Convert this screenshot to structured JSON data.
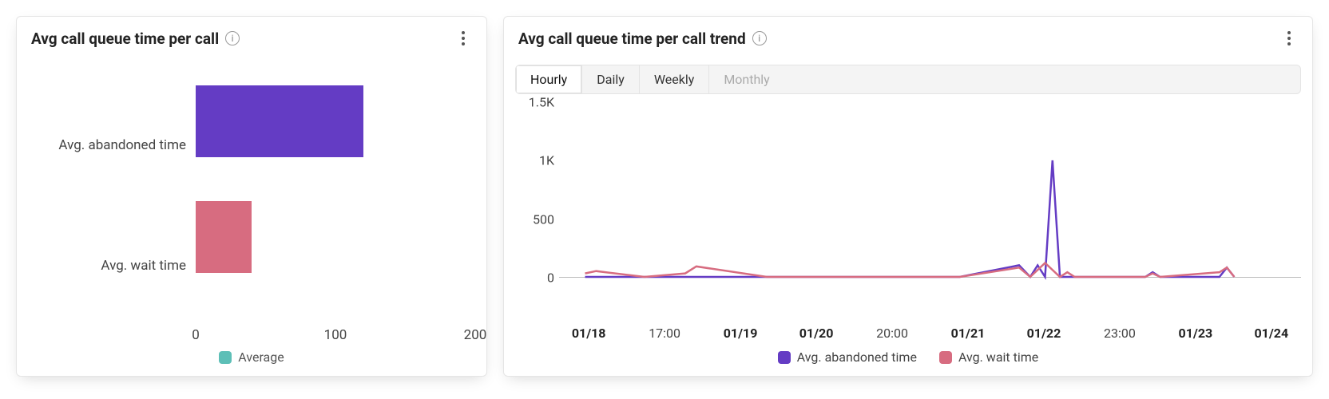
{
  "left": {
    "title": "Avg call queue time per call",
    "legend": "Average",
    "x_ticks": [
      0,
      100,
      200
    ],
    "bars": [
      {
        "label": "Avg. abandoned time",
        "color": "purple"
      },
      {
        "label": "Avg. wait time",
        "color": "pink"
      }
    ]
  },
  "right": {
    "title": "Avg call queue time per call trend",
    "segments": [
      "Hourly",
      "Daily",
      "Weekly",
      "Monthly"
    ],
    "active_segment": "Hourly",
    "disabled_segments": [
      "Monthly"
    ],
    "y_ticks": [
      "1.5K",
      "1K",
      "500",
      "0"
    ],
    "x_ticks": [
      {
        "label": "01/18",
        "bold": true
      },
      {
        "label": "17:00",
        "bold": false
      },
      {
        "label": "01/19",
        "bold": true
      },
      {
        "label": "01/20",
        "bold": true
      },
      {
        "label": "20:00",
        "bold": false
      },
      {
        "label": "01/21",
        "bold": true
      },
      {
        "label": "01/22",
        "bold": true
      },
      {
        "label": "23:00",
        "bold": false
      },
      {
        "label": "01/23",
        "bold": true
      },
      {
        "label": "01/24",
        "bold": true
      }
    ],
    "legend": [
      {
        "label": "Avg. abandoned time",
        "color": "purple"
      },
      {
        "label": "Avg. wait time",
        "color": "pink"
      }
    ]
  },
  "colors": {
    "purple": "#643cc4",
    "pink": "#d76c80",
    "teal": "#5dbfb7"
  },
  "chart_data": [
    {
      "type": "bar",
      "orientation": "horizontal",
      "title": "Avg call queue time per call",
      "categories": [
        "Avg. abandoned time",
        "Avg. wait time"
      ],
      "values": [
        120,
        40
      ],
      "xlabel": "",
      "ylabel": "",
      "xlim": [
        0,
        200
      ],
      "legend": [
        "Average"
      ],
      "colors": [
        "#643cc4",
        "#d76c80"
      ]
    },
    {
      "type": "line",
      "title": "Avg call queue time per call trend",
      "granularity": "Hourly",
      "x": [
        "01/18 00:00",
        "01/18 01:00",
        "01/18 17:00",
        "01/19 00:00",
        "01/19 01:00",
        "01/20 00:00",
        "01/20 20:00",
        "01/21 00:00",
        "01/22 00:00",
        "01/22 17:00",
        "01/22 20:00",
        "01/22 21:00",
        "01/22 22:00",
        "01/22 23:00",
        "01/23 00:00",
        "01/23 01:00",
        "01/23 02:00",
        "01/23 10:00",
        "01/23 11:00",
        "01/23 12:00",
        "01/23 22:00",
        "01/23 23:00",
        "01/24 00:00"
      ],
      "x_fraction": [
        0.035,
        0.05,
        0.115,
        0.17,
        0.185,
        0.28,
        0.38,
        0.4,
        0.54,
        0.62,
        0.635,
        0.645,
        0.655,
        0.665,
        0.675,
        0.685,
        0.695,
        0.79,
        0.8,
        0.81,
        0.89,
        0.9,
        0.91
      ],
      "series": [
        {
          "name": "Avg. abandoned time",
          "color": "#643cc4",
          "values": [
            0,
            0,
            0,
            0,
            0,
            0,
            0,
            0,
            0,
            100,
            0,
            100,
            0,
            1000,
            0,
            0,
            0,
            0,
            40,
            0,
            0,
            80,
            0
          ]
        },
        {
          "name": "Avg. wait time",
          "color": "#d76c80",
          "values": [
            30,
            50,
            0,
            30,
            90,
            0,
            0,
            0,
            0,
            80,
            0,
            60,
            120,
            60,
            0,
            40,
            0,
            0,
            30,
            0,
            40,
            80,
            0
          ]
        }
      ],
      "ylim": [
        0,
        1500
      ],
      "y_tick_labels": [
        "0",
        "500",
        "1K",
        "1.5K"
      ],
      "xlabel": "",
      "ylabel": ""
    }
  ]
}
